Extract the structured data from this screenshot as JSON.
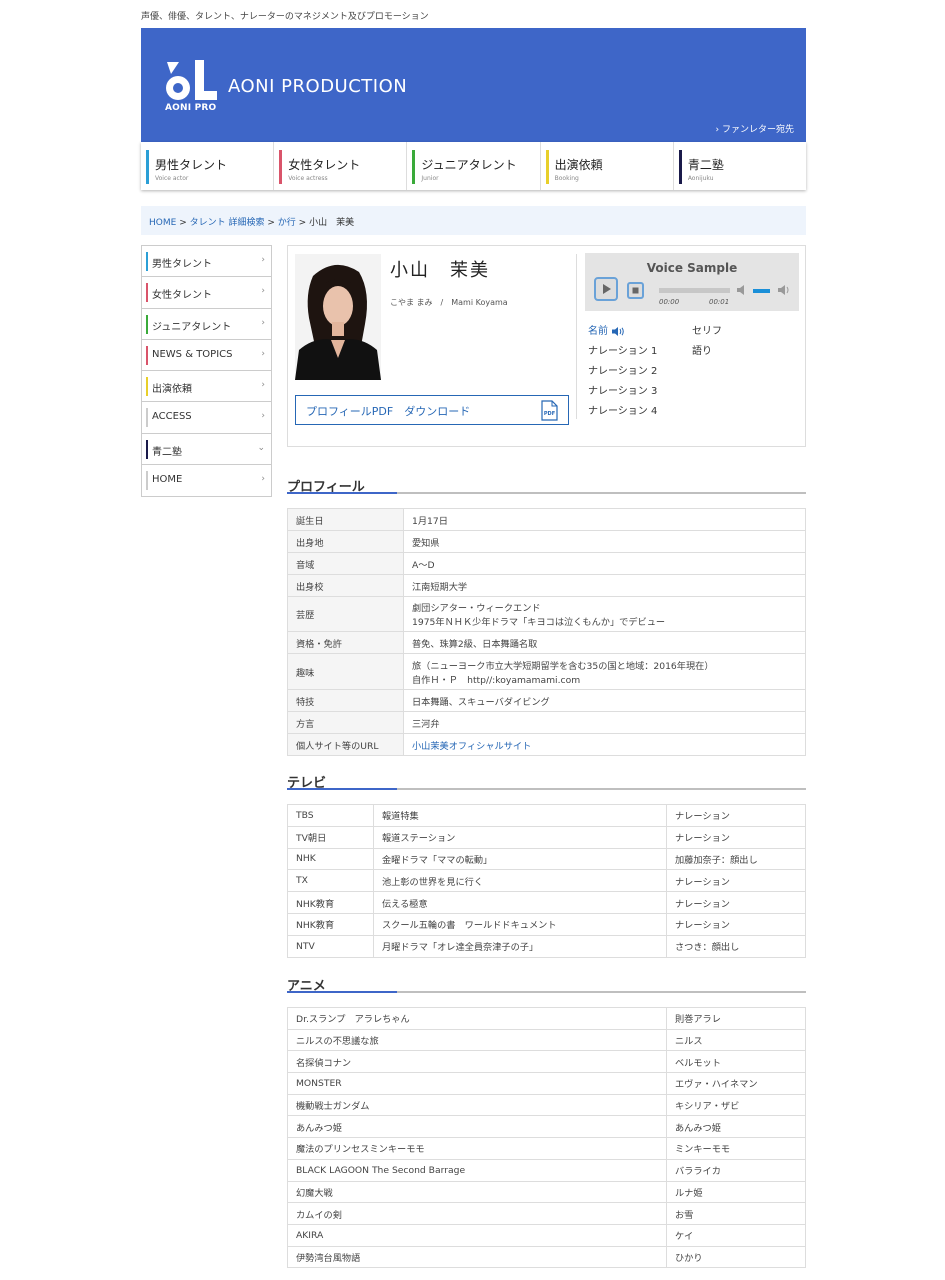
{
  "tagline": "声優、俳優、タレント、ナレーターのマネジメント及びプロモーション",
  "header": {
    "logo_sub": "AONI PRO",
    "brand": "AONI PRODUCTION",
    "fan_letter": "ファンレター宛先",
    "bg_color": "#3e66c8"
  },
  "global_nav": [
    {
      "main": "男性タレント",
      "sub": "Voice actor",
      "color": "#2b9fd6"
    },
    {
      "main": "女性タレント",
      "sub": "Voice actress",
      "color": "#d9546a"
    },
    {
      "main": "ジュニアタレント",
      "sub": "Junior",
      "color": "#3aaa3a"
    },
    {
      "main": "出演依頼",
      "sub": "Booking",
      "color": "#e8cf2a"
    },
    {
      "main": "青二塾",
      "sub": "Aonijuku",
      "color": "#1a1a4a"
    }
  ],
  "breadcrumb": {
    "home": "HOME",
    "sep": ">",
    "search": "タレント 詳細検索",
    "row": "か行",
    "current": "小山　茉美"
  },
  "side_nav": [
    {
      "label": "男性タレント",
      "color": "#2b9fd6",
      "chev": "›"
    },
    {
      "label": "女性タレント",
      "color": "#d9546a",
      "chev": "›"
    },
    {
      "label": "ジュニアタレント",
      "color": "#3aaa3a",
      "chev": "›"
    },
    {
      "label": "NEWS & TOPICS",
      "color": "#d9546a",
      "chev": "›"
    },
    {
      "label": "出演依頼",
      "color": "#e8cf2a",
      "chev": "›"
    },
    {
      "label": "ACCESS",
      "color": "#cccccc",
      "chev": "›"
    },
    {
      "label": "青二塾",
      "color": "#1a1a4a",
      "chev": "⌄"
    },
    {
      "label": "HOME",
      "color": "#cccccc",
      "chev": "›"
    }
  ],
  "profile": {
    "name": "小山　茉美",
    "reading": "こやま まみ　/　Mami Koyama",
    "pdf_label": "プロフィールPDF　ダウンロード",
    "pdf_icon_text": "PDF"
  },
  "voice": {
    "title": "Voice Sample",
    "time_current": "00:00",
    "time_total": "00:01",
    "samples_left": [
      "名前",
      "ナレーション 1",
      "ナレーション 2",
      "ナレーション 3",
      "ナレーション 4"
    ],
    "samples_right": [
      "セリフ",
      "語り"
    ]
  },
  "sections": {
    "profile": "プロフィール",
    "tv": "テレビ",
    "anime": "アニメ"
  },
  "profile_table": [
    {
      "key": "誕生日",
      "val": "1月17日"
    },
    {
      "key": "出身地",
      "val": "愛知県"
    },
    {
      "key": "音域",
      "val": "A～D"
    },
    {
      "key": "出身校",
      "val": "江南短期大学"
    },
    {
      "key": "芸歴",
      "val": "劇団シアター・ウィークエンド",
      "val2": "1975年ＮＨＫ少年ドラマ「キヨコは泣くもんか」でデビュー"
    },
    {
      "key": "資格・免許",
      "val": "普免、珠算2級、日本舞踊名取"
    },
    {
      "key": "趣味",
      "val": "旅（ニューヨーク市立大学短期留学を含む35の国と地域：2016年現在）",
      "val2": "自作Ｈ・Ｐ　http//:koyamamami.com"
    },
    {
      "key": "特技",
      "val": "日本舞踊、スキューバダイビング"
    },
    {
      "key": "方言",
      "val": "三河弁"
    },
    {
      "key": "個人サイト等のURL",
      "val": "小山茉美オフィシャルサイト",
      "link": true
    }
  ],
  "tv_table": [
    {
      "station": "TBS",
      "program": "報道特集",
      "role": "ナレーション"
    },
    {
      "station": "TV朝日",
      "program": "報道ステーション",
      "role": "ナレーション"
    },
    {
      "station": "NHK",
      "program": "金曜ドラマ「ママの転動」",
      "role": "加藤加奈子：顔出し"
    },
    {
      "station": "TX",
      "program": "池上彰の世界を見に行く",
      "role": "ナレーション"
    },
    {
      "station": "NHK教育",
      "program": "伝える極意",
      "role": "ナレーション"
    },
    {
      "station": "NHK教育",
      "program": "スクール五輪の書　ワールドドキュメント",
      "role": "ナレーション"
    },
    {
      "station": "NTV",
      "program": "月曜ドラマ「オレ達全員奈津子の子」",
      "role": "さつき：顔出し"
    }
  ],
  "anime_table": [
    {
      "title": "Dr.スランプ　アラレちゃん",
      "role": "則巻アラレ"
    },
    {
      "title": "ニルスの不思議な旅",
      "role": "ニルス"
    },
    {
      "title": "名探偵コナン",
      "role": "ベルモット"
    },
    {
      "title": "MONSTER",
      "role": "エヴァ・ハイネマン"
    },
    {
      "title": "機動戦士ガンダム",
      "role": "キシリア・ザビ"
    },
    {
      "title": "あんみつ姫",
      "role": "あんみつ姫"
    },
    {
      "title": "魔法のプリンセスミンキーモモ",
      "role": "ミンキーモモ"
    },
    {
      "title": "BLACK LAGOON The Second Barrage",
      "role": "バラライカ"
    },
    {
      "title": "幻魔大戦",
      "role": "ルナ姫"
    },
    {
      "title": "カムイの剣",
      "role": "お雪"
    },
    {
      "title": "AKIRA",
      "role": "ケイ"
    },
    {
      "title": "伊勢湾台風物語",
      "role": "ひかり"
    }
  ]
}
